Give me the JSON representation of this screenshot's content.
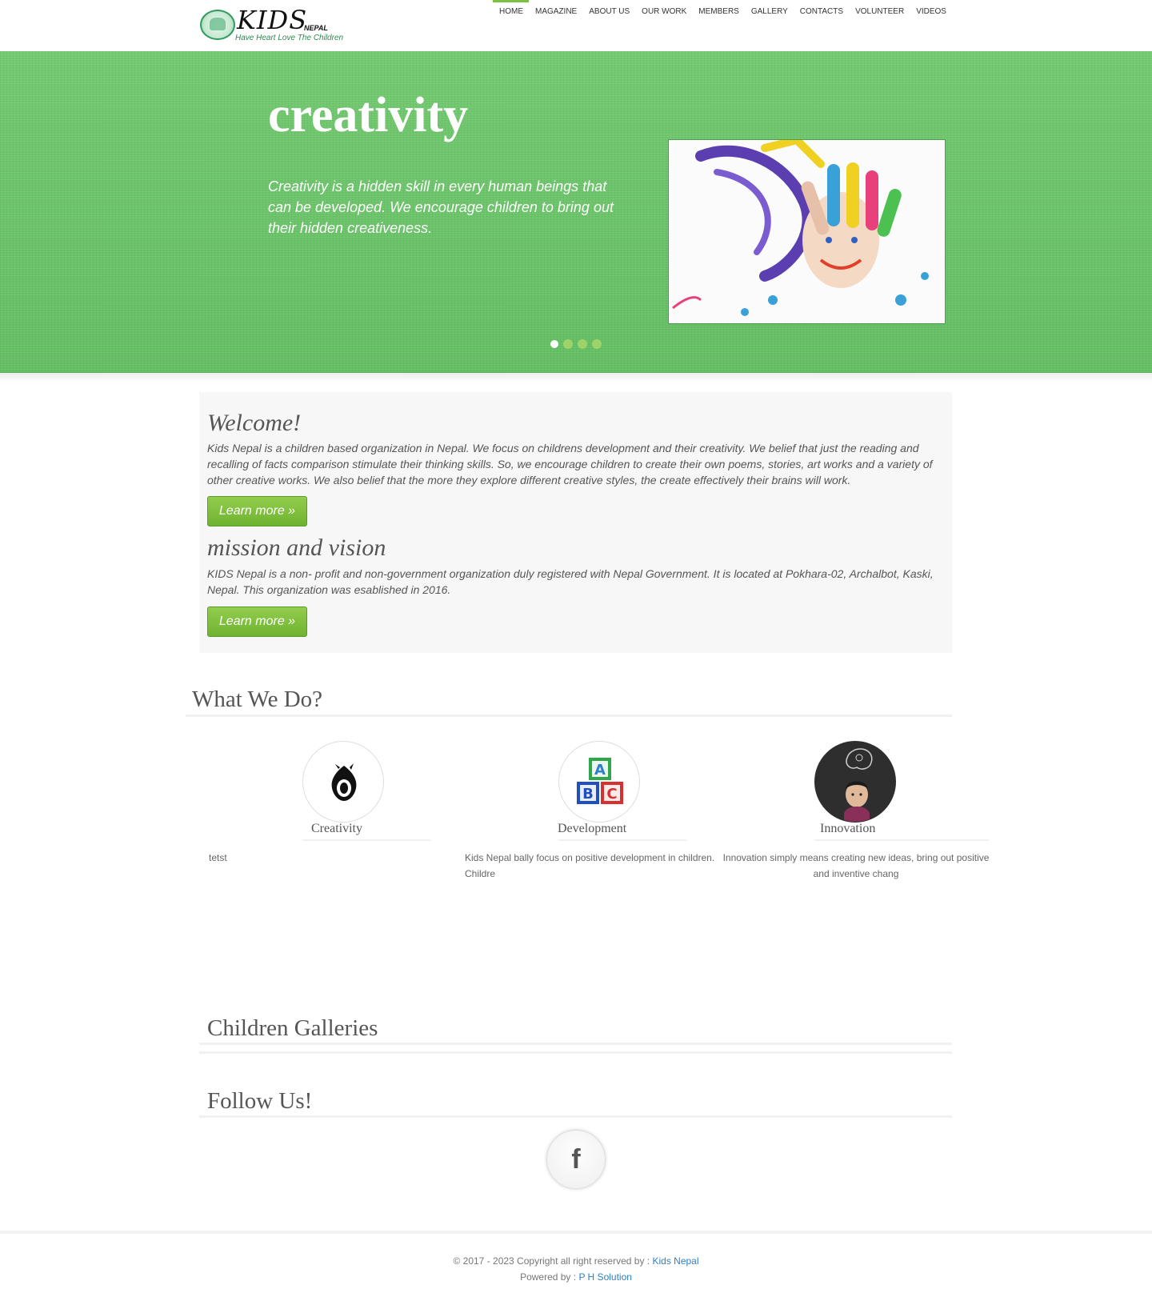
{
  "logo": {
    "word": "KIDS",
    "nepal": "NEPAL",
    "tagline": "Have Heart Love The Children"
  },
  "nav": {
    "items": [
      {
        "label": "HOME",
        "active": true
      },
      {
        "label": "MAGAZINE"
      },
      {
        "label": "ABOUT US"
      },
      {
        "label": "OUR WORK"
      },
      {
        "label": "MEMBERS"
      },
      {
        "label": "GALLERY"
      },
      {
        "label": "CONTACTS"
      },
      {
        "label": "VOLUNTEER"
      },
      {
        "label": "VIDEOS"
      }
    ]
  },
  "hero": {
    "title": "creativity",
    "text": "Creativity is a hidden skill in every human beings that can be developed. We encourage children to bring out their hidden creativeness.",
    "image_subject": "painted-hand-image",
    "slide_count": 4,
    "active_slide": 1
  },
  "intro": {
    "welcome_title": "Welcome!",
    "welcome_text": "Kids Nepal is a children based organization in Nepal. We focus on childrens development and their creativity. We belief that just the reading and recalling of facts comparison stimulate their thinking skills. So, we encourage children to create their own poems, stories, art works and a variety of other creative works. We also belief that the more they explore different creative styles, the create effectively their brains will work.",
    "welcome_button": "Learn more »",
    "mission_title": "mission and vision",
    "mission_text": "KIDS Nepal is a non- profit and non-government organization duly registered with Nepal Government. It is located at Pokhara-02, Archalbot, Kaski, Nepal. This organization was esablished in 2016.",
    "mission_button": "Learn more »"
  },
  "what_we_do": {
    "title": "What We Do?",
    "services": [
      {
        "title": "Creativity",
        "text": "tetst",
        "icon": "flame-icon"
      },
      {
        "title": "Development",
        "text": "Kids Nepal bally focus on positive development in children. Childre",
        "icon": "abc-blocks-icon"
      },
      {
        "title": "Innovation",
        "text": "Innovation simply means creating new ideas, bring out positive and inventive chang",
        "icon": "thinking-child-icon"
      }
    ]
  },
  "galleries": {
    "title": "Children Galleries"
  },
  "follow": {
    "title": "Follow Us!",
    "facebook_glyph": "f"
  },
  "footer": {
    "copyright": "© 2017 - 2023 Copyright all right reserved by : ",
    "copyright_link": "Kids Nepal",
    "powered": "Powered by : ",
    "powered_link": "P H Solution"
  },
  "colors": {
    "accent": "#7cc242",
    "hero_green": "#6cc56a",
    "link": "#2f7fc6"
  }
}
